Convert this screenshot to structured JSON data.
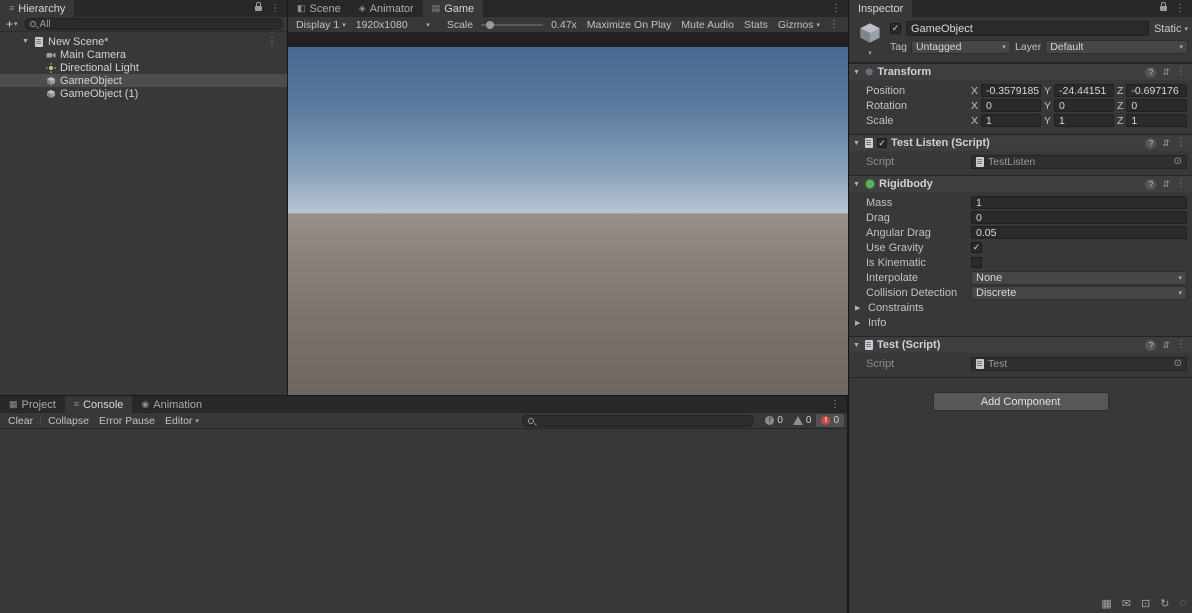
{
  "hierarchy": {
    "tab": "Hierarchy",
    "create_button": "+",
    "search_label": "All",
    "scene_row": "New Scene*",
    "items": [
      {
        "label": "Main Camera",
        "icon": "camera-icon"
      },
      {
        "label": "Directional Light",
        "icon": "light-icon"
      },
      {
        "label": "GameObject",
        "icon": "cube-icon",
        "selected": true
      },
      {
        "label": "GameObject (1)",
        "icon": "cube-icon"
      }
    ]
  },
  "game_view": {
    "tabs": [
      "Scene",
      "Animator",
      "Game"
    ],
    "active_tab": "Game",
    "toolbar": {
      "display": "Display 1",
      "resolution": "1920x1080",
      "scale_label": "Scale",
      "scale_value": "0.47x",
      "maximize_on_play": "Maximize On Play",
      "mute_audio": "Mute Audio",
      "stats": "Stats",
      "gizmos": "Gizmos"
    }
  },
  "console": {
    "tabs": [
      "Project",
      "Console",
      "Animation"
    ],
    "active_tab": "Console",
    "toolbar": {
      "clear": "Clear",
      "collapse": "Collapse",
      "error_pause": "Error Pause",
      "editor": "Editor",
      "info_count": "0",
      "warning_count": "0",
      "error_count": "0"
    }
  },
  "inspector": {
    "tab": "Inspector",
    "game_object": {
      "name": "GameObject",
      "static_label": "Static",
      "tag_label": "Tag",
      "tag_value": "Untagged",
      "layer_label": "Layer",
      "layer_value": "Default"
    },
    "axes": [
      "X",
      "Y",
      "Z"
    ],
    "transform": {
      "title": "Transform",
      "rows": [
        {
          "label": "Position",
          "x": "-0.3579185",
          "y": "-24.44151",
          "z": "-0.697176"
        },
        {
          "label": "Rotation",
          "x": "0",
          "y": "0",
          "z": "0"
        },
        {
          "label": "Scale",
          "x": "1",
          "y": "1",
          "z": "1"
        }
      ]
    },
    "test_listen": {
      "title": "Test Listen (Script)",
      "script_label": "Script",
      "script_value": "TestListen"
    },
    "rigidbody": {
      "title": "Rigidbody",
      "mass_label": "Mass",
      "mass_value": "1",
      "drag_label": "Drag",
      "drag_value": "0",
      "angular_drag_label": "Angular Drag",
      "angular_drag_value": "0.05",
      "use_gravity_label": "Use Gravity",
      "is_kinematic_label": "Is Kinematic",
      "interpolate_label": "Interpolate",
      "interpolate_value": "None",
      "collision_label": "Collision Detection",
      "collision_value": "Discrete",
      "constraints_label": "Constraints",
      "info_label": "Info"
    },
    "test_script": {
      "title": "Test (Script)",
      "script_label": "Script",
      "script_value": "Test"
    },
    "add_component": "Add Component"
  },
  "colors": {
    "accent_selection": "#4d4d4d",
    "panel_bg": "#383838",
    "strip_bg": "#282828",
    "error_red": "#d04545",
    "rigidbody_green": "#5fae5f"
  }
}
